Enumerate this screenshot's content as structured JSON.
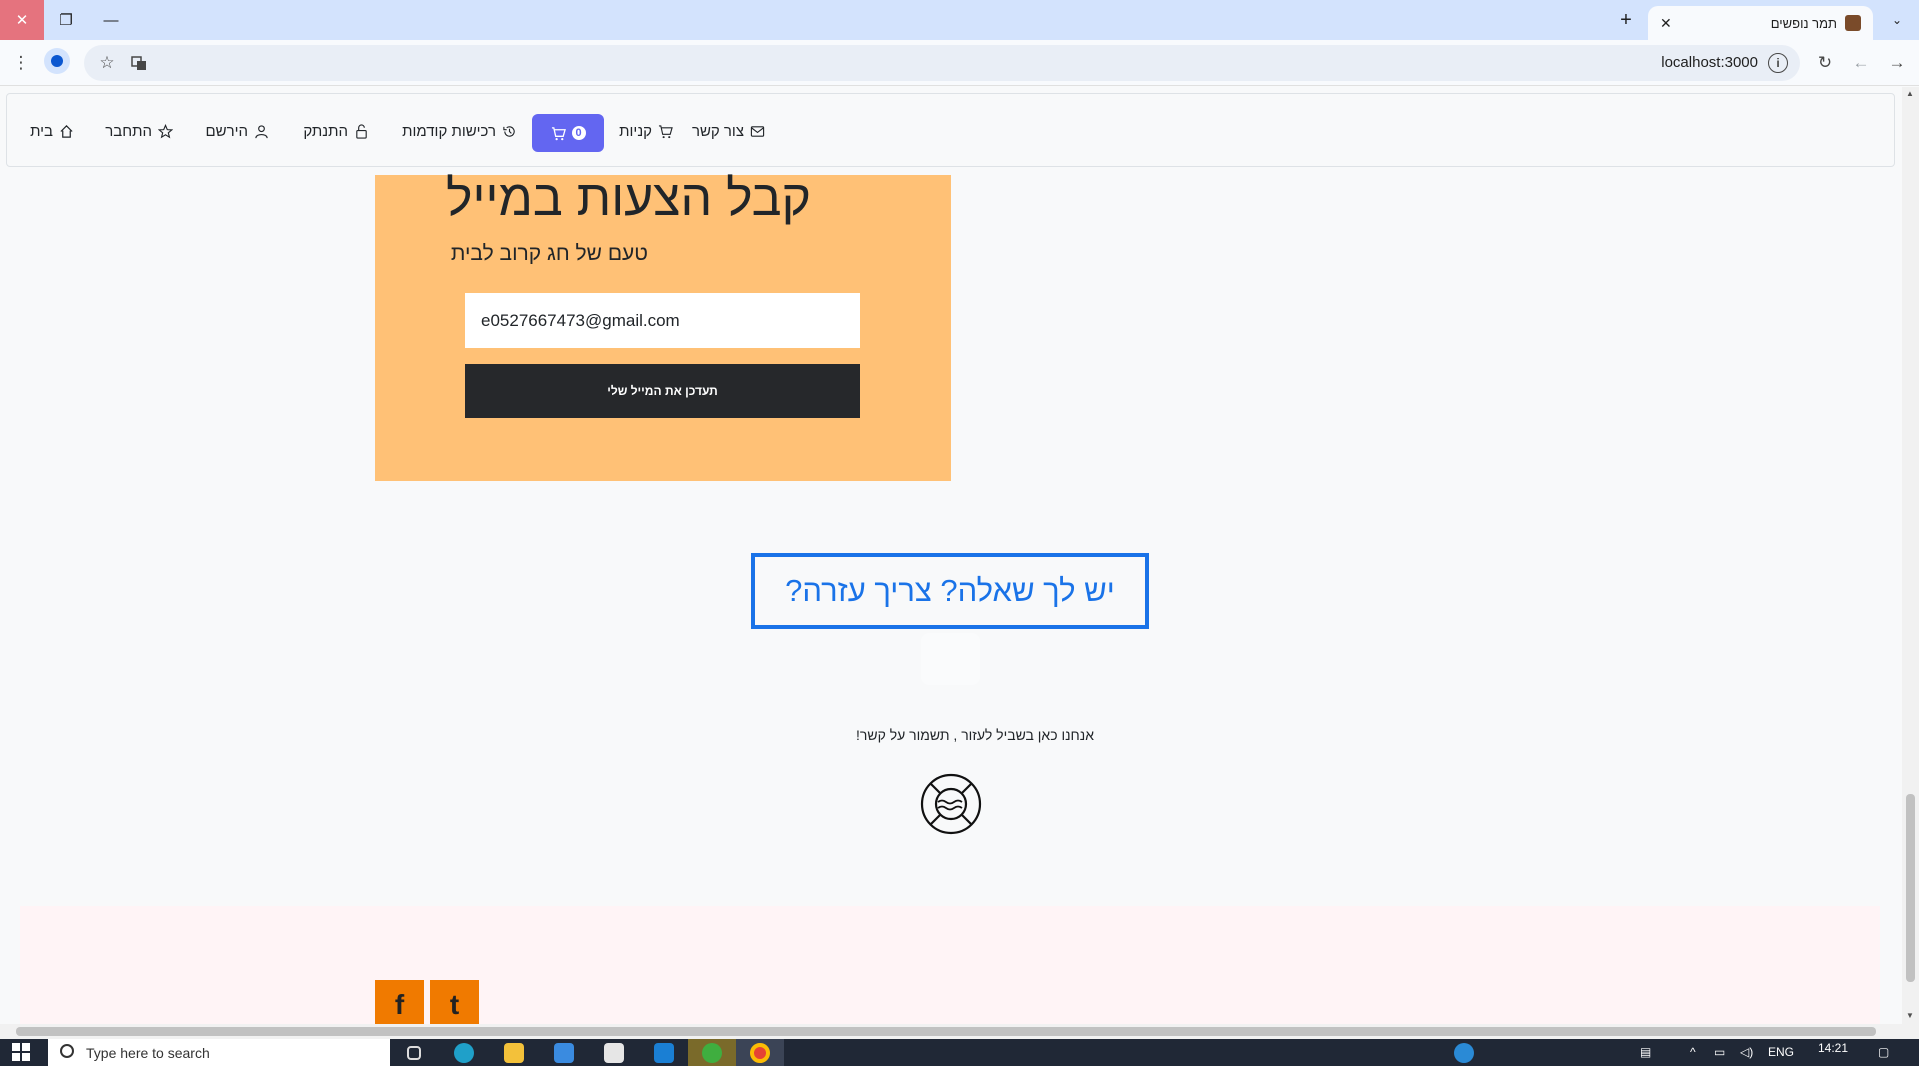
{
  "browser": {
    "tab_title": "תמר נופשים",
    "tab_close": "✕",
    "new_tab": "+",
    "window_close": "✕",
    "window_restore": "❐",
    "window_minimize": "—",
    "tablist": "⌄",
    "url": "localhost:3000",
    "menu": "⋮",
    "bookmark": "☆",
    "reload": "↻",
    "back": "←",
    "forward": "→"
  },
  "nav": {
    "home": "בית",
    "login": "התחבר",
    "register": "הירשם",
    "logout": "התנתק",
    "previous_orders": "רכישות קודמות",
    "cart_count": "0",
    "purchases": "קניות",
    "contact": "צור קשר"
  },
  "newsletter": {
    "title": "קבל הצעות במייל",
    "subtitle": "טעם של חג קרוב לבית",
    "email_value": "e0527667473@gmail.com",
    "button_label": "תעדכן את המייל שלי",
    "background_color": "#ffc176"
  },
  "help": {
    "heading": "?יש לך שאלה? צריך עזרה",
    "text": "!אנחנו כאן בשביל לעזור , תשמור על קשר",
    "accent_color": "#1a73e8"
  },
  "footer": {
    "facebook_label": "f",
    "twitter_label": "t",
    "social_color": "#f07a00"
  },
  "taskbar": {
    "search_placeholder": "Type here to search",
    "language": "ENG",
    "time": "14:21"
  }
}
